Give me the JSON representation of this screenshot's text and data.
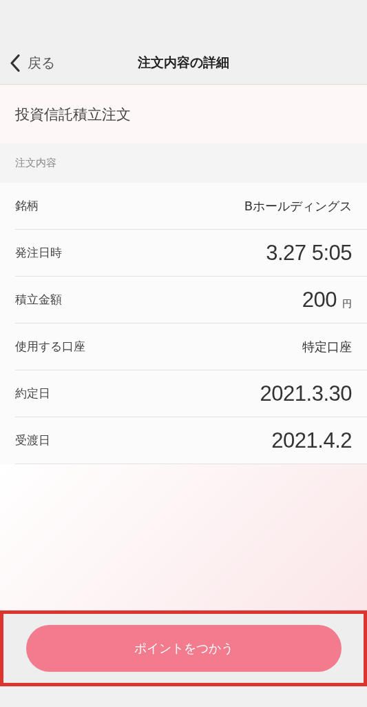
{
  "nav": {
    "back_label": "戻る",
    "title": "注文内容の詳細"
  },
  "order_type": "投資信託積立注文",
  "section_header": "注文内容",
  "rows": [
    {
      "label": "銘柄",
      "value": "Bホールディングス",
      "kind": "text"
    },
    {
      "label": "発注日時",
      "value": "3.27 5:05",
      "kind": "large"
    },
    {
      "label": "積立金額",
      "value": "200",
      "unit": "円",
      "kind": "large"
    },
    {
      "label": "使用する口座",
      "value": "特定口座",
      "kind": "text"
    },
    {
      "label": "約定日",
      "value": "2021.3.30",
      "kind": "large"
    },
    {
      "label": "受渡日",
      "value": "2021.4.2",
      "kind": "large"
    }
  ],
  "action_button": {
    "label": "ポイントをつかう",
    "highlighted": true
  }
}
